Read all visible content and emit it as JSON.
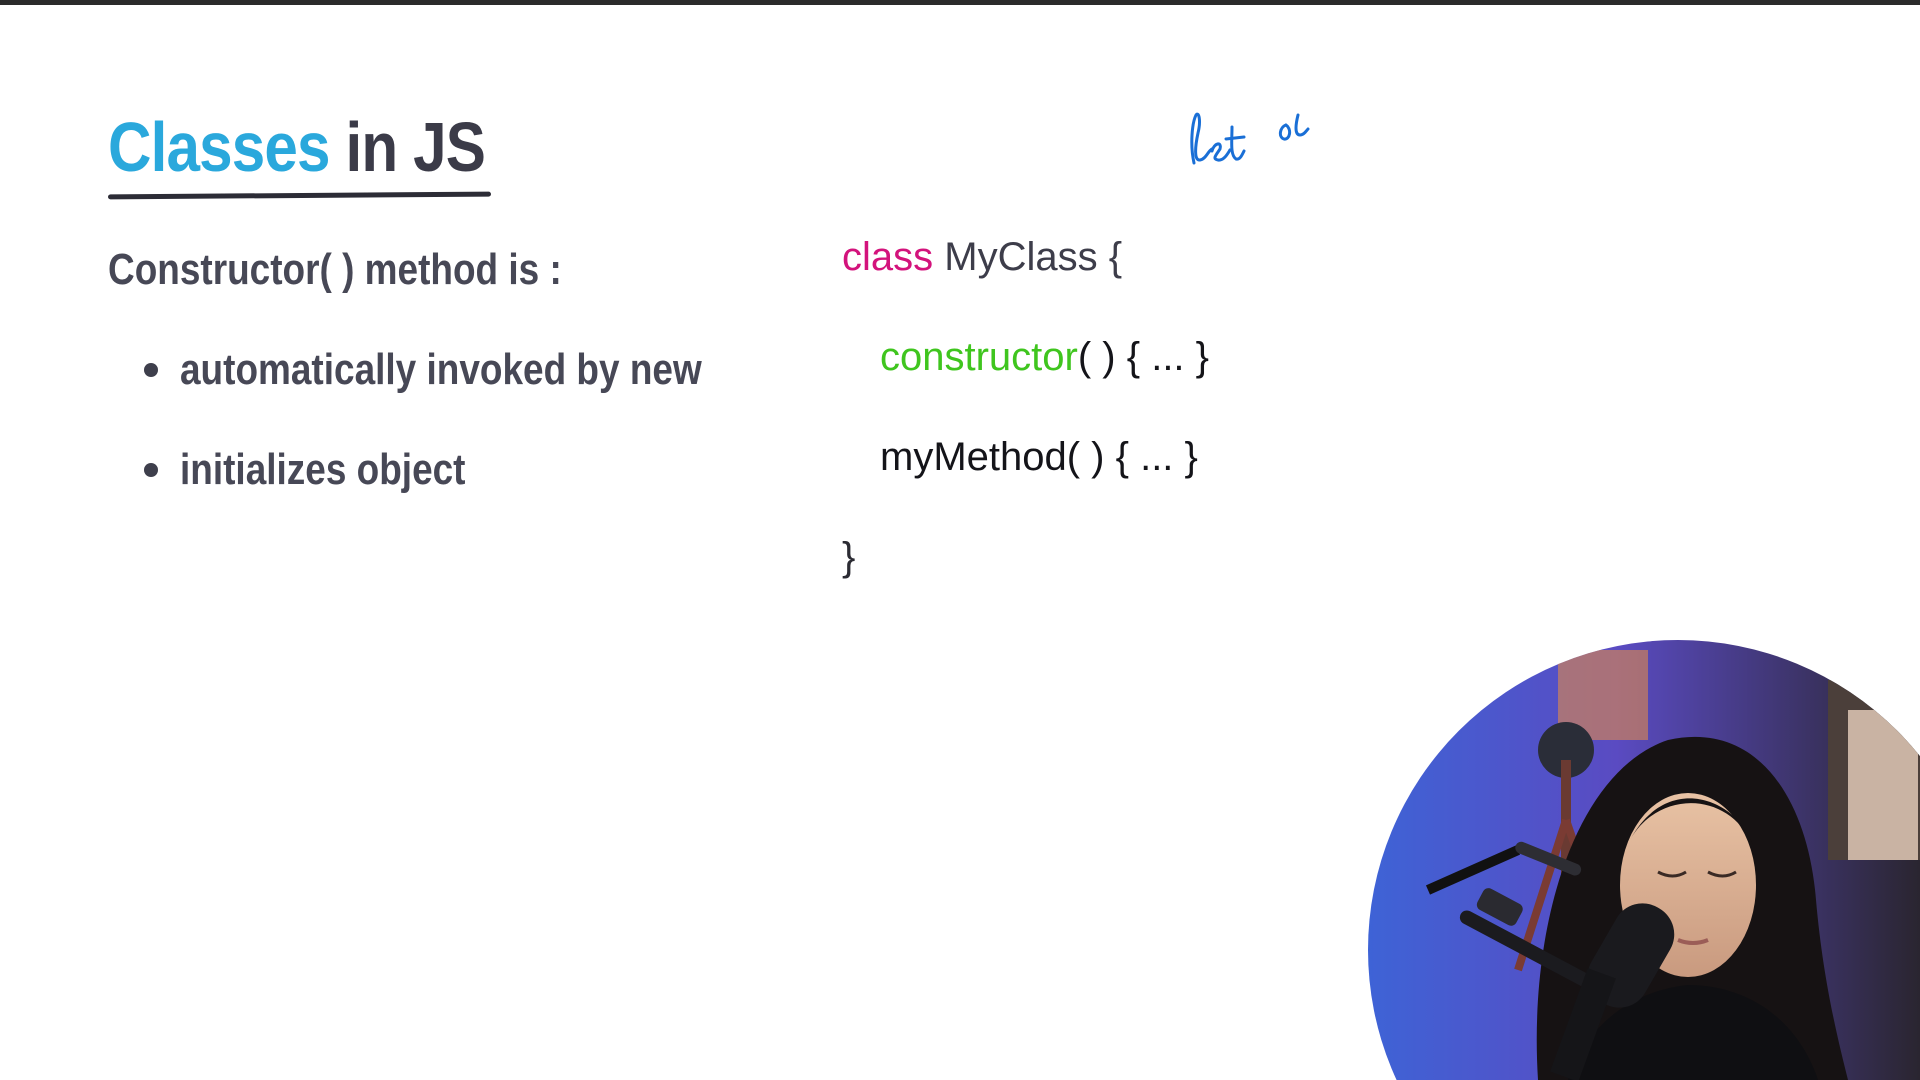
{
  "slide": {
    "title_part1": "Classes",
    "title_part2": "in JS",
    "subheading": "Constructor( ) method is :",
    "bullets": [
      "automatically invoked by new",
      "initializes object"
    ],
    "annotation": "let ol"
  },
  "code": {
    "line1_keyword": "class",
    "line1_name": "MyClass {",
    "line2_keyword": "constructor",
    "line2_rest": "( ) { ... }",
    "line3": "myMethod( ) { ... }",
    "line4": "}"
  },
  "colors": {
    "title_accent": "#2aa8dc",
    "title_dark": "#3b3b48",
    "keyword": "#d3137c",
    "constructor": "#3fc51e",
    "handwriting": "#1a6fd6"
  },
  "webcam": {
    "icon": "presenter-webcam"
  }
}
